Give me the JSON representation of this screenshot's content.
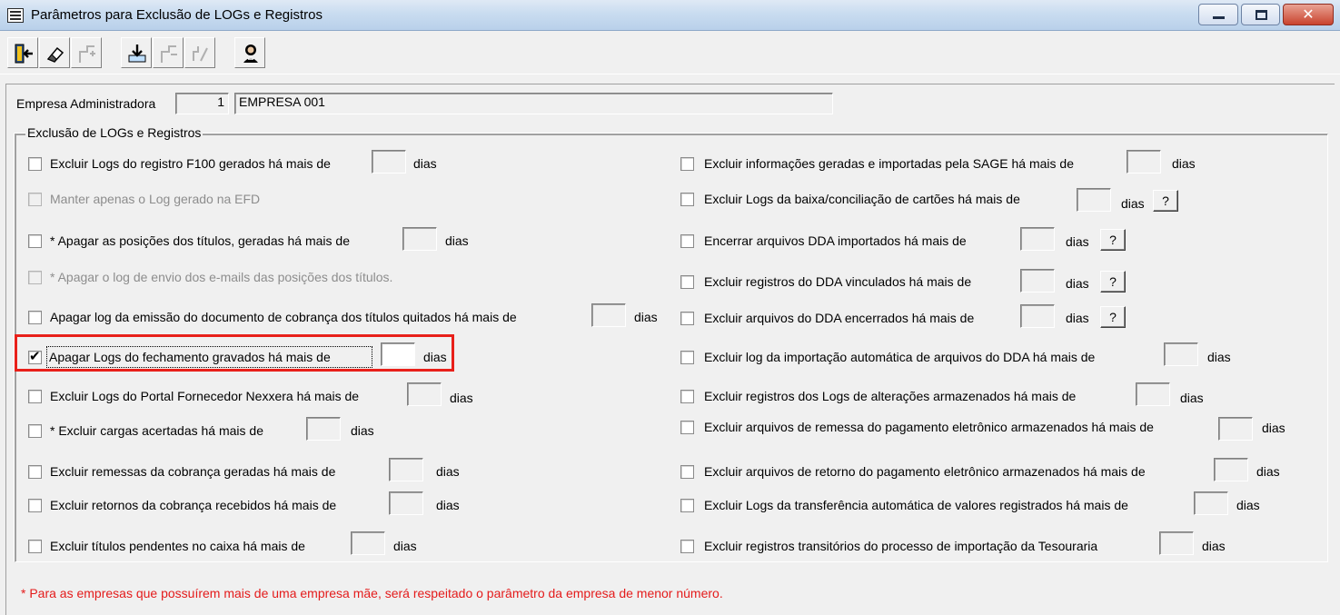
{
  "window": {
    "title": "Parâmetros para Exclusão de LOGs e Registros",
    "close_glyph": "✕"
  },
  "toolbar": {
    "buttons": [
      {
        "name": "exit",
        "icon": "exit-door-icon",
        "enabled": true
      },
      {
        "name": "clear",
        "icon": "eraser-icon",
        "enabled": true
      },
      {
        "name": "insert",
        "icon": "insert-row-icon",
        "enabled": false
      },
      {
        "name": "save",
        "icon": "save-tray-icon",
        "enabled": true
      },
      {
        "name": "delete",
        "icon": "delete-row-icon",
        "enabled": false
      },
      {
        "name": "edit",
        "icon": "edit-icon",
        "enabled": false
      },
      {
        "name": "help",
        "icon": "help-person-icon",
        "enabled": true
      }
    ]
  },
  "empresa": {
    "label": "Empresa Administradora",
    "code": "1",
    "name": "EMPRESA 001"
  },
  "group": {
    "title": "Exclusão de LOGs e Registros"
  },
  "left_items": [
    {
      "text": "Excluir Logs do registro F100 gerados há mais de",
      "suffix": "dias",
      "checked": false,
      "enabled": true,
      "value": ""
    },
    {
      "text": "Manter apenas o Log gerado na EFD",
      "suffix": "",
      "checked": false,
      "enabled": false,
      "value": ""
    },
    {
      "text": "* Apagar as posições dos títulos, geradas há mais de",
      "suffix": "dias",
      "checked": false,
      "enabled": true,
      "value": ""
    },
    {
      "text": "* Apagar o log de envio dos e-mails das posições dos títulos.",
      "suffix": "",
      "checked": false,
      "enabled": false,
      "value": ""
    },
    {
      "text": "Apagar log da emissão do documento de cobrança dos títulos quitados há mais de",
      "suffix": "dias",
      "checked": false,
      "enabled": true,
      "value": ""
    },
    {
      "text": "Apagar Logs do fechamento gravados há mais de",
      "suffix": "dias",
      "checked": true,
      "enabled": true,
      "value": ""
    },
    {
      "text": "Excluir Logs do Portal Fornecedor Nexxera há mais de",
      "suffix": "dias",
      "checked": false,
      "enabled": true,
      "value": ""
    },
    {
      "text": "* Excluir cargas acertadas há mais de",
      "suffix": "dias",
      "checked": false,
      "enabled": true,
      "value": ""
    },
    {
      "text": "Excluir remessas da cobrança geradas há mais de",
      "suffix": "dias",
      "checked": false,
      "enabled": true,
      "value": ""
    },
    {
      "text": "Excluir retornos da cobrança recebidos há mais de",
      "suffix": "dias",
      "checked": false,
      "enabled": true,
      "value": ""
    },
    {
      "text": "Excluir títulos pendentes no caixa há mais de",
      "suffix": "dias",
      "checked": false,
      "enabled": true,
      "value": ""
    }
  ],
  "right_items": [
    {
      "text": "Excluir informações geradas e importadas pela SAGE há mais de",
      "suffix": "dias",
      "help": "",
      "checked": false,
      "value": ""
    },
    {
      "text": "Excluir Logs da baixa/conciliação de cartões há mais de",
      "suffix": "dias",
      "help": "?",
      "checked": false,
      "value": ""
    },
    {
      "text": "Encerrar arquivos DDA importados há mais de",
      "suffix": "dias",
      "help": "?",
      "checked": false,
      "value": ""
    },
    {
      "text": "Excluir registros do DDA vinculados há mais de",
      "suffix": "dias",
      "help": "?",
      "checked": false,
      "value": ""
    },
    {
      "text": "Excluir arquivos do DDA encerrados há mais de",
      "suffix": "dias",
      "help": "?",
      "checked": false,
      "value": ""
    },
    {
      "text": "Excluir log da importação automática de arquivos do DDA há mais de",
      "suffix": "dias",
      "help": "",
      "checked": false,
      "value": ""
    },
    {
      "text": "Excluir registros dos Logs de alterações armazenados há mais de",
      "suffix": "dias",
      "help": "",
      "checked": false,
      "value": ""
    },
    {
      "text": "Excluir arquivos de remessa do pagamento eletrônico armazenados há mais de",
      "suffix": "dias",
      "help": "",
      "checked": false,
      "value": ""
    },
    {
      "text": "Excluir arquivos de retorno do pagamento eletrônico armazenados há mais de",
      "suffix": "dias",
      "help": "",
      "checked": false,
      "value": ""
    },
    {
      "text": "Excluir Logs da transferência automática de valores registrados há mais de",
      "suffix": "dias",
      "help": "",
      "checked": false,
      "value": ""
    },
    {
      "text": "Excluir registros transitórios do processo de importação da Tesouraria",
      "suffix": "dias",
      "help": "",
      "checked": false,
      "value": ""
    }
  ],
  "footnote": "* Para as empresas que possuírem mais de uma empresa mãe, será respeitado o parâmetro da empresa de menor número.",
  "colors": {
    "highlight": "#e8201a",
    "footnote": "#e41b1b",
    "disabled_text": "#8d8d8d"
  }
}
